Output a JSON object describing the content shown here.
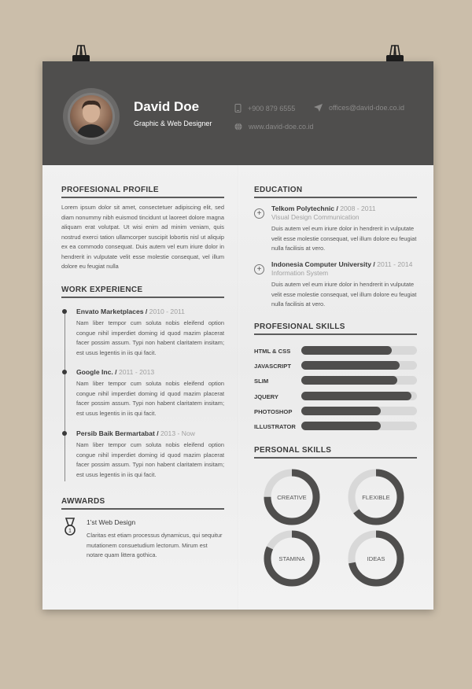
{
  "header": {
    "name": "David Doe",
    "title": "Graphic & Web Designer",
    "phone": "+900 879 6555",
    "email": "offices@david-doe.co.id",
    "website": "www.david-doe.co.id"
  },
  "profile": {
    "heading": "PROFESIONAL PROFILE",
    "text": "Lorem ipsum dolor sit amet, consectetuer adipiscing elit, sed diam nonummy nibh euismod tincidunt ut laoreet dolore magna aliquam erat volutpat. Ut wisi enim ad minim veniam, quis nostrud exerci tation ullamcorper suscipit lobortis nisl ut aliquip ex ea commodo consequat. Duis autem vel eum iriure dolor in hendrerit in vulputate velit esse molestie consequat, vel illum dolore eu feugiat nulla"
  },
  "work": {
    "heading": "WORK EXPERIENCE",
    "items": [
      {
        "company": "Envato Marketplaces",
        "sep": " / ",
        "years": "2010 - 2011",
        "text": "Nam liber tempor cum soluta nobis eleifend option congue nihil imperdiet doming id quod mazim placerat facer possim assum. Typi non habent claritatem insitam; est usus legentis in iis qui facit."
      },
      {
        "company": "Google Inc.",
        "sep": " / ",
        "years": "2011 - 2013",
        "text": "Nam liber tempor cum soluta nobis eleifend option congue nihil imperdiet doming id quod mazim placerat facer possim assum. Typi non habent claritatem insitam; est usus legentis in iis qui facit."
      },
      {
        "company": "Persib Baik Bermartabat",
        "sep": " / ",
        "years": "2013 - Now",
        "text": "Nam liber tempor cum soluta nobis eleifend option congue nihil imperdiet doming id quod mazim placerat facer possim assum. Typi non habent claritatem insitam; est usus legentis in iis qui facit."
      }
    ]
  },
  "awards": {
    "heading": "AWWARDS",
    "title": "1'st Web Design",
    "text": "Claritas est etiam processus dynamicus, qui sequitur mutationem consuetudium lectorum. Mirum est notare quam littera gothica."
  },
  "education": {
    "heading": "EDUCATION",
    "items": [
      {
        "school": "Telkom Polytechnic",
        "sep": " / ",
        "years": "2008 - 2011",
        "field": "Visual Design Communication",
        "text": "Duis autem vel eum iriure dolor in hendrerit in vulputate velit esse molestie consequat, vel illum dolore eu feugiat nulla facilisis at vero."
      },
      {
        "school": "Indonesia Computer University",
        "sep": " / ",
        "years": "2011 - 2014",
        "field": "Information System",
        "text": "Duis autem vel eum iriure dolor in hendrerit in vulputate velit esse molestie consequat, vel illum dolore eu feugiat nulla facilisis at vero."
      }
    ]
  },
  "skills": {
    "heading": "PROFESIONAL SKILLS",
    "items": [
      {
        "name": "HTML & CSS",
        "level": 0.78
      },
      {
        "name": "JAVASCRIPT",
        "level": 0.85
      },
      {
        "name": "SLIM",
        "level": 0.83
      },
      {
        "name": "JQUERY",
        "level": 0.95
      },
      {
        "name": "PHOTOSHOP",
        "level": 0.69
      },
      {
        "name": "ILLUSTRATOR",
        "level": 0.69
      }
    ]
  },
  "personal": {
    "heading": "PERSONAL SKILLS",
    "items": [
      {
        "name": "CREATIVE",
        "level": 0.75
      },
      {
        "name": "FLEXIBLE",
        "level": 0.65
      },
      {
        "name": "STAMINA",
        "level": 0.82
      },
      {
        "name": "IDEAS",
        "level": 0.72
      }
    ]
  },
  "colors": {
    "dark": "#4f4e4d",
    "track": "#d8d8d8",
    "background": "#cbbeaa"
  }
}
